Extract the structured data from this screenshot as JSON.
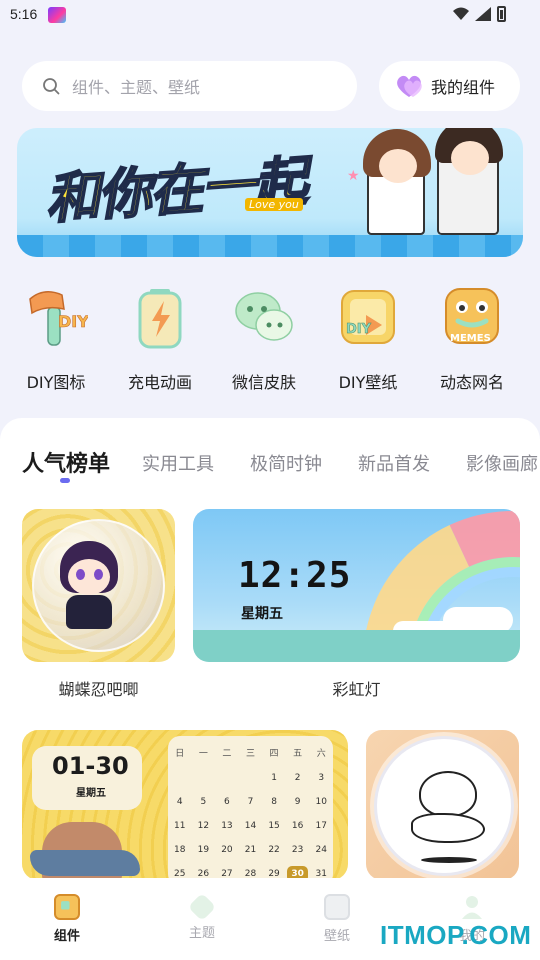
{
  "status_bar": {
    "time": "5:16"
  },
  "search": {
    "placeholder": "组件、主题、壁纸"
  },
  "my_widgets": {
    "label": "我的组件"
  },
  "banner": {
    "title": "和你在一起",
    "subtitle": "Love you"
  },
  "categories": [
    {
      "label": "DIY图标",
      "icon": "diy-hammer-icon"
    },
    {
      "label": "充电动画",
      "icon": "battery-charge-icon"
    },
    {
      "label": "微信皮肤",
      "icon": "wechat-icon"
    },
    {
      "label": "DIY壁纸",
      "icon": "diy-wallpaper-icon"
    },
    {
      "label": "动态网名",
      "icon": "memes-icon"
    }
  ],
  "tabs": [
    {
      "label": "人气榜单",
      "active": true
    },
    {
      "label": "实用工具"
    },
    {
      "label": "极简时钟"
    },
    {
      "label": "新品首发"
    },
    {
      "label": "影像画廊"
    }
  ],
  "cards": [
    {
      "label": "蝴蝶忍吧唧"
    },
    {
      "label": "彩虹灯",
      "time": "12:25",
      "weekday": "星期五"
    },
    {
      "date": "01-30",
      "weekday": "星期五"
    },
    {}
  ],
  "calendar": {
    "headers": [
      "日",
      "一",
      "二",
      "三",
      "四",
      "五",
      "六"
    ],
    "days": [
      "",
      "",
      "",
      "",
      "1",
      "2",
      "3",
      "4",
      "5",
      "6",
      "7",
      "8",
      "9",
      "10",
      "11",
      "12",
      "13",
      "14",
      "15",
      "16",
      "17",
      "18",
      "19",
      "20",
      "21",
      "22",
      "23",
      "24",
      "25",
      "26",
      "27",
      "28",
      "29",
      "30",
      "31"
    ],
    "highlight": "30"
  },
  "bottom_nav": [
    {
      "label": "组件",
      "active": true
    },
    {
      "label": "主题"
    },
    {
      "label": "壁纸"
    },
    {
      "label": "我的"
    }
  ],
  "watermark": "ITMOP.COM",
  "colors": {
    "accent": "#6b6cf0",
    "background": "#f1f2fb"
  }
}
